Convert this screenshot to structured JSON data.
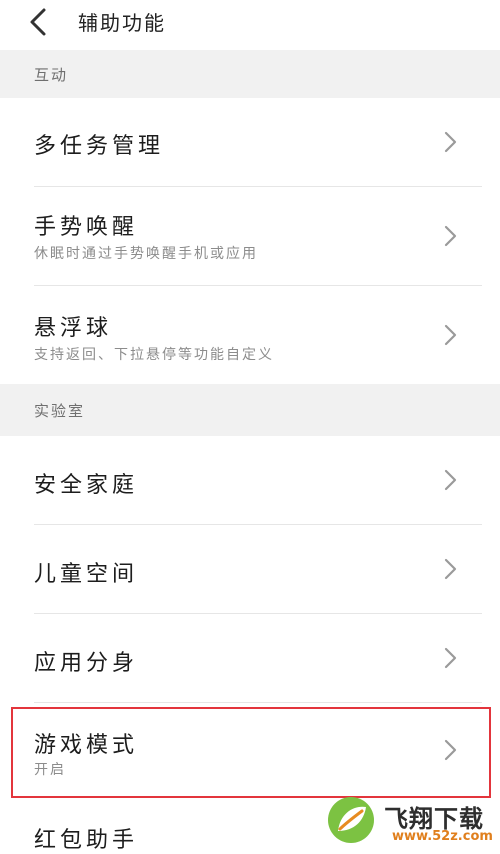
{
  "header": {
    "title": "辅助功能"
  },
  "sections": [
    {
      "label": "互动"
    },
    {
      "label": "实验室"
    }
  ],
  "items": [
    {
      "label": "多任务管理",
      "sub": ""
    },
    {
      "label": "手势唤醒",
      "sub": "休眠时通过手势唤醒手机或应用"
    },
    {
      "label": "悬浮球",
      "sub": "支持返回、下拉悬停等功能自定义"
    },
    {
      "label": "安全家庭",
      "sub": ""
    },
    {
      "label": "儿童空间",
      "sub": ""
    },
    {
      "label": "应用分身",
      "sub": ""
    },
    {
      "label": "游戏模式",
      "sub": "开启"
    },
    {
      "label": "红包助手",
      "sub": ""
    }
  ],
  "watermark": {
    "brand": "飞翔下载",
    "url": "www.52z.com"
  },
  "colors": {
    "highlight": "#e3353c",
    "section_bg": "#f1f1f1",
    "watermark_url": "#e07f1d"
  }
}
